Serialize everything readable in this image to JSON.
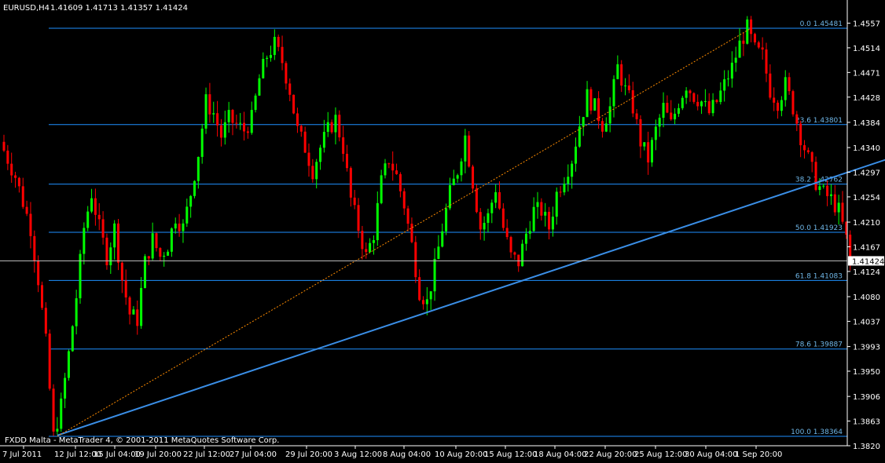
{
  "header": {
    "symbol": "EURUSD,H4",
    "ohlc": "1.41609 1.41713 1.41357 1.41424"
  },
  "footer": {
    "copyright": "FXDD Malta - MetaTrader 4, © 2001-2011 MetaQuotes Software Corp."
  },
  "colors": {
    "background": "#000000",
    "bull": "#00ff00",
    "bear": "#ff0000",
    "fib": "#1e90ff",
    "trendline": "#3a8ee6",
    "dotted": "#ff8c00",
    "axis": "#ffffff"
  },
  "chart_data": {
    "type": "candlestick",
    "symbol": "EURUSD",
    "timeframe": "H4",
    "ylim": [
      1.382,
      1.457
    ],
    "y_ticks": [
      "1.4557",
      "1.4514",
      "1.4471",
      "1.4428",
      "1.4384",
      "1.4340",
      "1.4297",
      "1.4254",
      "1.4210",
      "1.4167",
      "1.4124",
      "1.4080",
      "1.4037",
      "1.3993",
      "1.3950",
      "1.3906",
      "1.3863",
      "1.3820"
    ],
    "x_ticks": [
      "7 Jul 2011",
      "12 Jul 12:00",
      "15 Jul 04:00",
      "19 Jul 20:00",
      "22 Jul 12:00",
      "27 Jul 04:00",
      "29 Jul 20:00",
      "3 Aug 12:00",
      "8 Aug 04:00",
      "10 Aug 20:00",
      "15 Aug 12:00",
      "18 Aug 04:00",
      "22 Aug 20:00",
      "25 Aug 12:00",
      "30 Aug 04:00",
      "1 Sep 20:00"
    ],
    "current_price": "1.41424",
    "fib_levels": [
      {
        "label": "0.0 1.45481",
        "price": 1.45481
      },
      {
        "label": "23.6 1.43801",
        "price": 1.43801
      },
      {
        "label": "38.2 1.42762",
        "price": 1.42762
      },
      {
        "label": "50.0 1.41923",
        "price": 1.41923
      },
      {
        "label": "61.8 1.41083",
        "price": 1.41083
      },
      {
        "label": "78.6 1.39887",
        "price": 1.39887
      },
      {
        "label": "100.0 1.38364",
        "price": 1.38364
      }
    ],
    "trendline": {
      "from": {
        "bar": 14,
        "price": 1.3838
      },
      "to": {
        "bar": 244,
        "price": 1.4347
      }
    },
    "fib_anchor_line": {
      "from": {
        "bar": 14,
        "price": 1.38364
      },
      "to": {
        "bar": 196,
        "price": 1.45481
      }
    },
    "price_path": [
      [
        0,
        1.435
      ],
      [
        4,
        1.429
      ],
      [
        8,
        1.42
      ],
      [
        10,
        1.411
      ],
      [
        12,
        1.4
      ],
      [
        14,
        1.3836
      ],
      [
        16,
        1.389
      ],
      [
        18,
        1.398
      ],
      [
        20,
        1.408
      ],
      [
        22,
        1.42
      ],
      [
        24,
        1.426
      ],
      [
        26,
        1.42
      ],
      [
        28,
        1.415
      ],
      [
        30,
        1.42
      ],
      [
        32,
        1.411
      ],
      [
        34,
        1.405
      ],
      [
        36,
        1.404
      ],
      [
        38,
        1.414
      ],
      [
        40,
        1.418
      ],
      [
        42,
        1.415
      ],
      [
        44,
        1.417
      ],
      [
        46,
        1.422
      ],
      [
        48,
        1.42
      ],
      [
        50,
        1.426
      ],
      [
        52,
        1.433
      ],
      [
        54,
        1.442
      ],
      [
        56,
        1.44
      ],
      [
        58,
        1.436
      ],
      [
        60,
        1.439
      ],
      [
        62,
        1.438
      ],
      [
        64,
        1.437
      ],
      [
        66,
        1.439
      ],
      [
        68,
        1.446
      ],
      [
        70,
        1.45
      ],
      [
        72,
        1.452
      ],
      [
        74,
        1.449
      ],
      [
        76,
        1.444
      ],
      [
        78,
        1.437
      ],
      [
        80,
        1.434
      ],
      [
        82,
        1.43
      ],
      [
        84,
        1.434
      ],
      [
        86,
        1.437
      ],
      [
        88,
        1.439
      ],
      [
        90,
        1.434
      ],
      [
        92,
        1.425
      ],
      [
        94,
        1.42
      ],
      [
        96,
        1.415
      ],
      [
        98,
        1.419
      ],
      [
        100,
        1.428
      ],
      [
        102,
        1.432
      ],
      [
        104,
        1.429
      ],
      [
        106,
        1.424
      ],
      [
        108,
        1.417
      ],
      [
        110,
        1.409
      ],
      [
        112,
        1.407
      ],
      [
        114,
        1.413
      ],
      [
        116,
        1.42
      ],
      [
        118,
        1.426
      ],
      [
        120,
        1.43
      ],
      [
        122,
        1.436
      ],
      [
        124,
        1.428
      ],
      [
        126,
        1.42
      ],
      [
        128,
        1.422
      ],
      [
        130,
        1.427
      ],
      [
        132,
        1.42
      ],
      [
        134,
        1.415
      ],
      [
        136,
        1.414
      ],
      [
        138,
        1.419
      ],
      [
        140,
        1.423
      ],
      [
        142,
        1.423
      ],
      [
        144,
        1.42
      ],
      [
        146,
        1.426
      ],
      [
        148,
        1.429
      ],
      [
        150,
        1.432
      ],
      [
        152,
        1.438
      ],
      [
        154,
        1.443
      ],
      [
        156,
        1.441
      ],
      [
        158,
        1.438
      ],
      [
        160,
        1.441
      ],
      [
        162,
        1.448
      ],
      [
        164,
        1.444
      ],
      [
        166,
        1.441
      ],
      [
        168,
        1.435
      ],
      [
        170,
        1.432
      ],
      [
        172,
        1.437
      ],
      [
        174,
        1.441
      ],
      [
        176,
        1.438
      ],
      [
        178,
        1.442
      ],
      [
        180,
        1.445
      ],
      [
        182,
        1.443
      ],
      [
        184,
        1.442
      ],
      [
        186,
        1.44
      ],
      [
        188,
        1.442
      ],
      [
        190,
        1.445
      ],
      [
        192,
        1.448
      ],
      [
        194,
        1.452
      ],
      [
        196,
        1.4548
      ],
      [
        198,
        1.451
      ],
      [
        200,
        1.45
      ],
      [
        202,
        1.444
      ],
      [
        204,
        1.442
      ],
      [
        206,
        1.445
      ],
      [
        208,
        1.441
      ],
      [
        210,
        1.436
      ],
      [
        212,
        1.432
      ],
      [
        214,
        1.428
      ],
      [
        216,
        1.426
      ],
      [
        218,
        1.425
      ],
      [
        220,
        1.423
      ],
      [
        222,
        1.418
      ],
      [
        223,
        1.4142
      ]
    ]
  }
}
